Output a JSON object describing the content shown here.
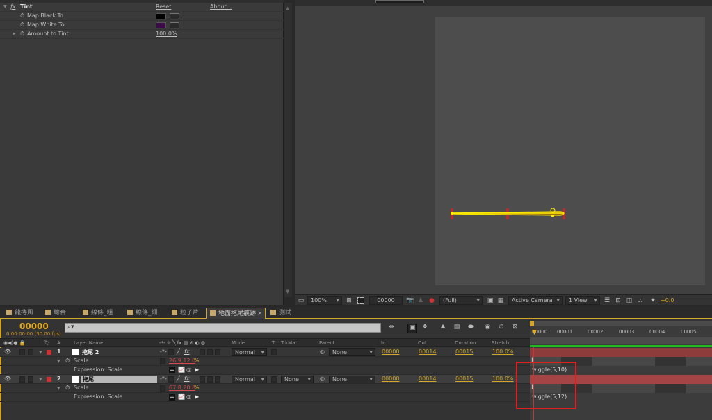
{
  "effects_panel": {
    "effect_name": "Tint",
    "reset_label": "Reset",
    "about_label": "About...",
    "properties": [
      {
        "label": "Map Black To",
        "color": "#000000"
      },
      {
        "label": "Map White To",
        "color": "#3d0a4a"
      },
      {
        "label": "Amount to Tint",
        "value": "100.0%"
      }
    ]
  },
  "viewer_toolbar": {
    "zoom": "100%",
    "timecode": "00000",
    "resolution": "(Full)",
    "camera": "Active Camera",
    "views": "1 View",
    "exposure": "+0.0"
  },
  "timeline": {
    "tabs": [
      {
        "label": "龍捲風"
      },
      {
        "label": "總合"
      },
      {
        "label": "線條_粗"
      },
      {
        "label": "線條_細"
      },
      {
        "label": "粒子片"
      },
      {
        "label": "地面拖尾痕跡",
        "active": true
      },
      {
        "label": "測試"
      }
    ],
    "current_time": "00000",
    "current_time_sub": "0:00:00:00 (30.00 fps)",
    "search_placeholder": "",
    "columns": {
      "hash": "#",
      "layer_name": "Layer Name",
      "mode": "Mode",
      "t": "T",
      "trkmat": "TrkMat",
      "parent": "Parent",
      "in": "In",
      "out": "Out",
      "duration": "Duration",
      "stretch": "Stretch"
    },
    "ruler_ticks": [
      "00000",
      "00001",
      "00002",
      "00003",
      "00004",
      "00005"
    ],
    "layers": [
      {
        "index": "1",
        "name": "拖尾 2",
        "label_color": "#c83232",
        "mode": "Normal",
        "trkmat": "",
        "parent": "None",
        "in": "00000",
        "out": "00014",
        "duration": "00015",
        "stretch": "100.0%",
        "scale_label": "Scale",
        "scale_value": "26.9,12.0",
        "scale_unit": "%",
        "expression_label": "Expression: Scale",
        "expression": "wiggle(5,10)"
      },
      {
        "index": "2",
        "name": "拖尾",
        "label_color": "#c83232",
        "mode": "Normal",
        "trkmat": "None",
        "parent": "None",
        "in": "00000",
        "out": "00014",
        "duration": "00015",
        "stretch": "100.0%",
        "scale_label": "Scale",
        "scale_value": "67.8,20.8",
        "scale_unit": "%",
        "expression_label": "Expression: Scale",
        "expression": "wiggle(5,12)"
      }
    ]
  },
  "colors": {
    "accent": "#d5a52a",
    "highlight_box": "#e02020",
    "layer_bar": "#8e3b3b",
    "work_area": "#22b822"
  }
}
